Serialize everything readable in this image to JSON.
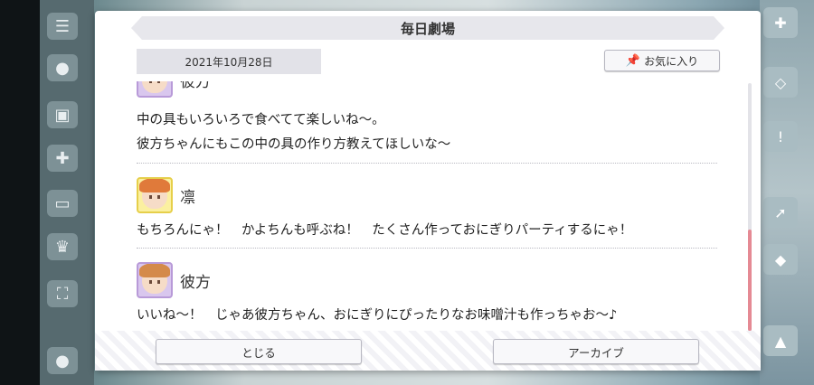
{
  "dialog": {
    "title": "毎日劇場",
    "date": "2021年10月28日",
    "favorite_label": "お気に入り",
    "favorite_icon": "pin-icon"
  },
  "log": [
    {
      "speaker": "彼方",
      "avatar": "kanata",
      "lines": [
        "中の具もいろいろで食べてて楽しいね～。",
        "彼方ちゃんにもこの中の具の作り方教えてほしいな～"
      ]
    },
    {
      "speaker": "凛",
      "avatar": "rin",
      "lines": [
        "もちろんにゃ！　かよちんも呼ぶね！　たくさん作っておにぎりパーティするにゃ！"
      ]
    },
    {
      "speaker": "彼方",
      "avatar": "kanata",
      "lines": [
        "いいね～！　じゃあ彼方ちゃん、おにぎりにぴったりなお味噌汁も作っちゃお～♪"
      ]
    }
  ],
  "buttons": {
    "close_label": "とじる",
    "archive_label": "アーカイブ"
  },
  "colors": {
    "scroll_thumb": "#e58a94",
    "kanata_frame": "#b89ad8",
    "rin_frame": "#e6cf4a"
  }
}
